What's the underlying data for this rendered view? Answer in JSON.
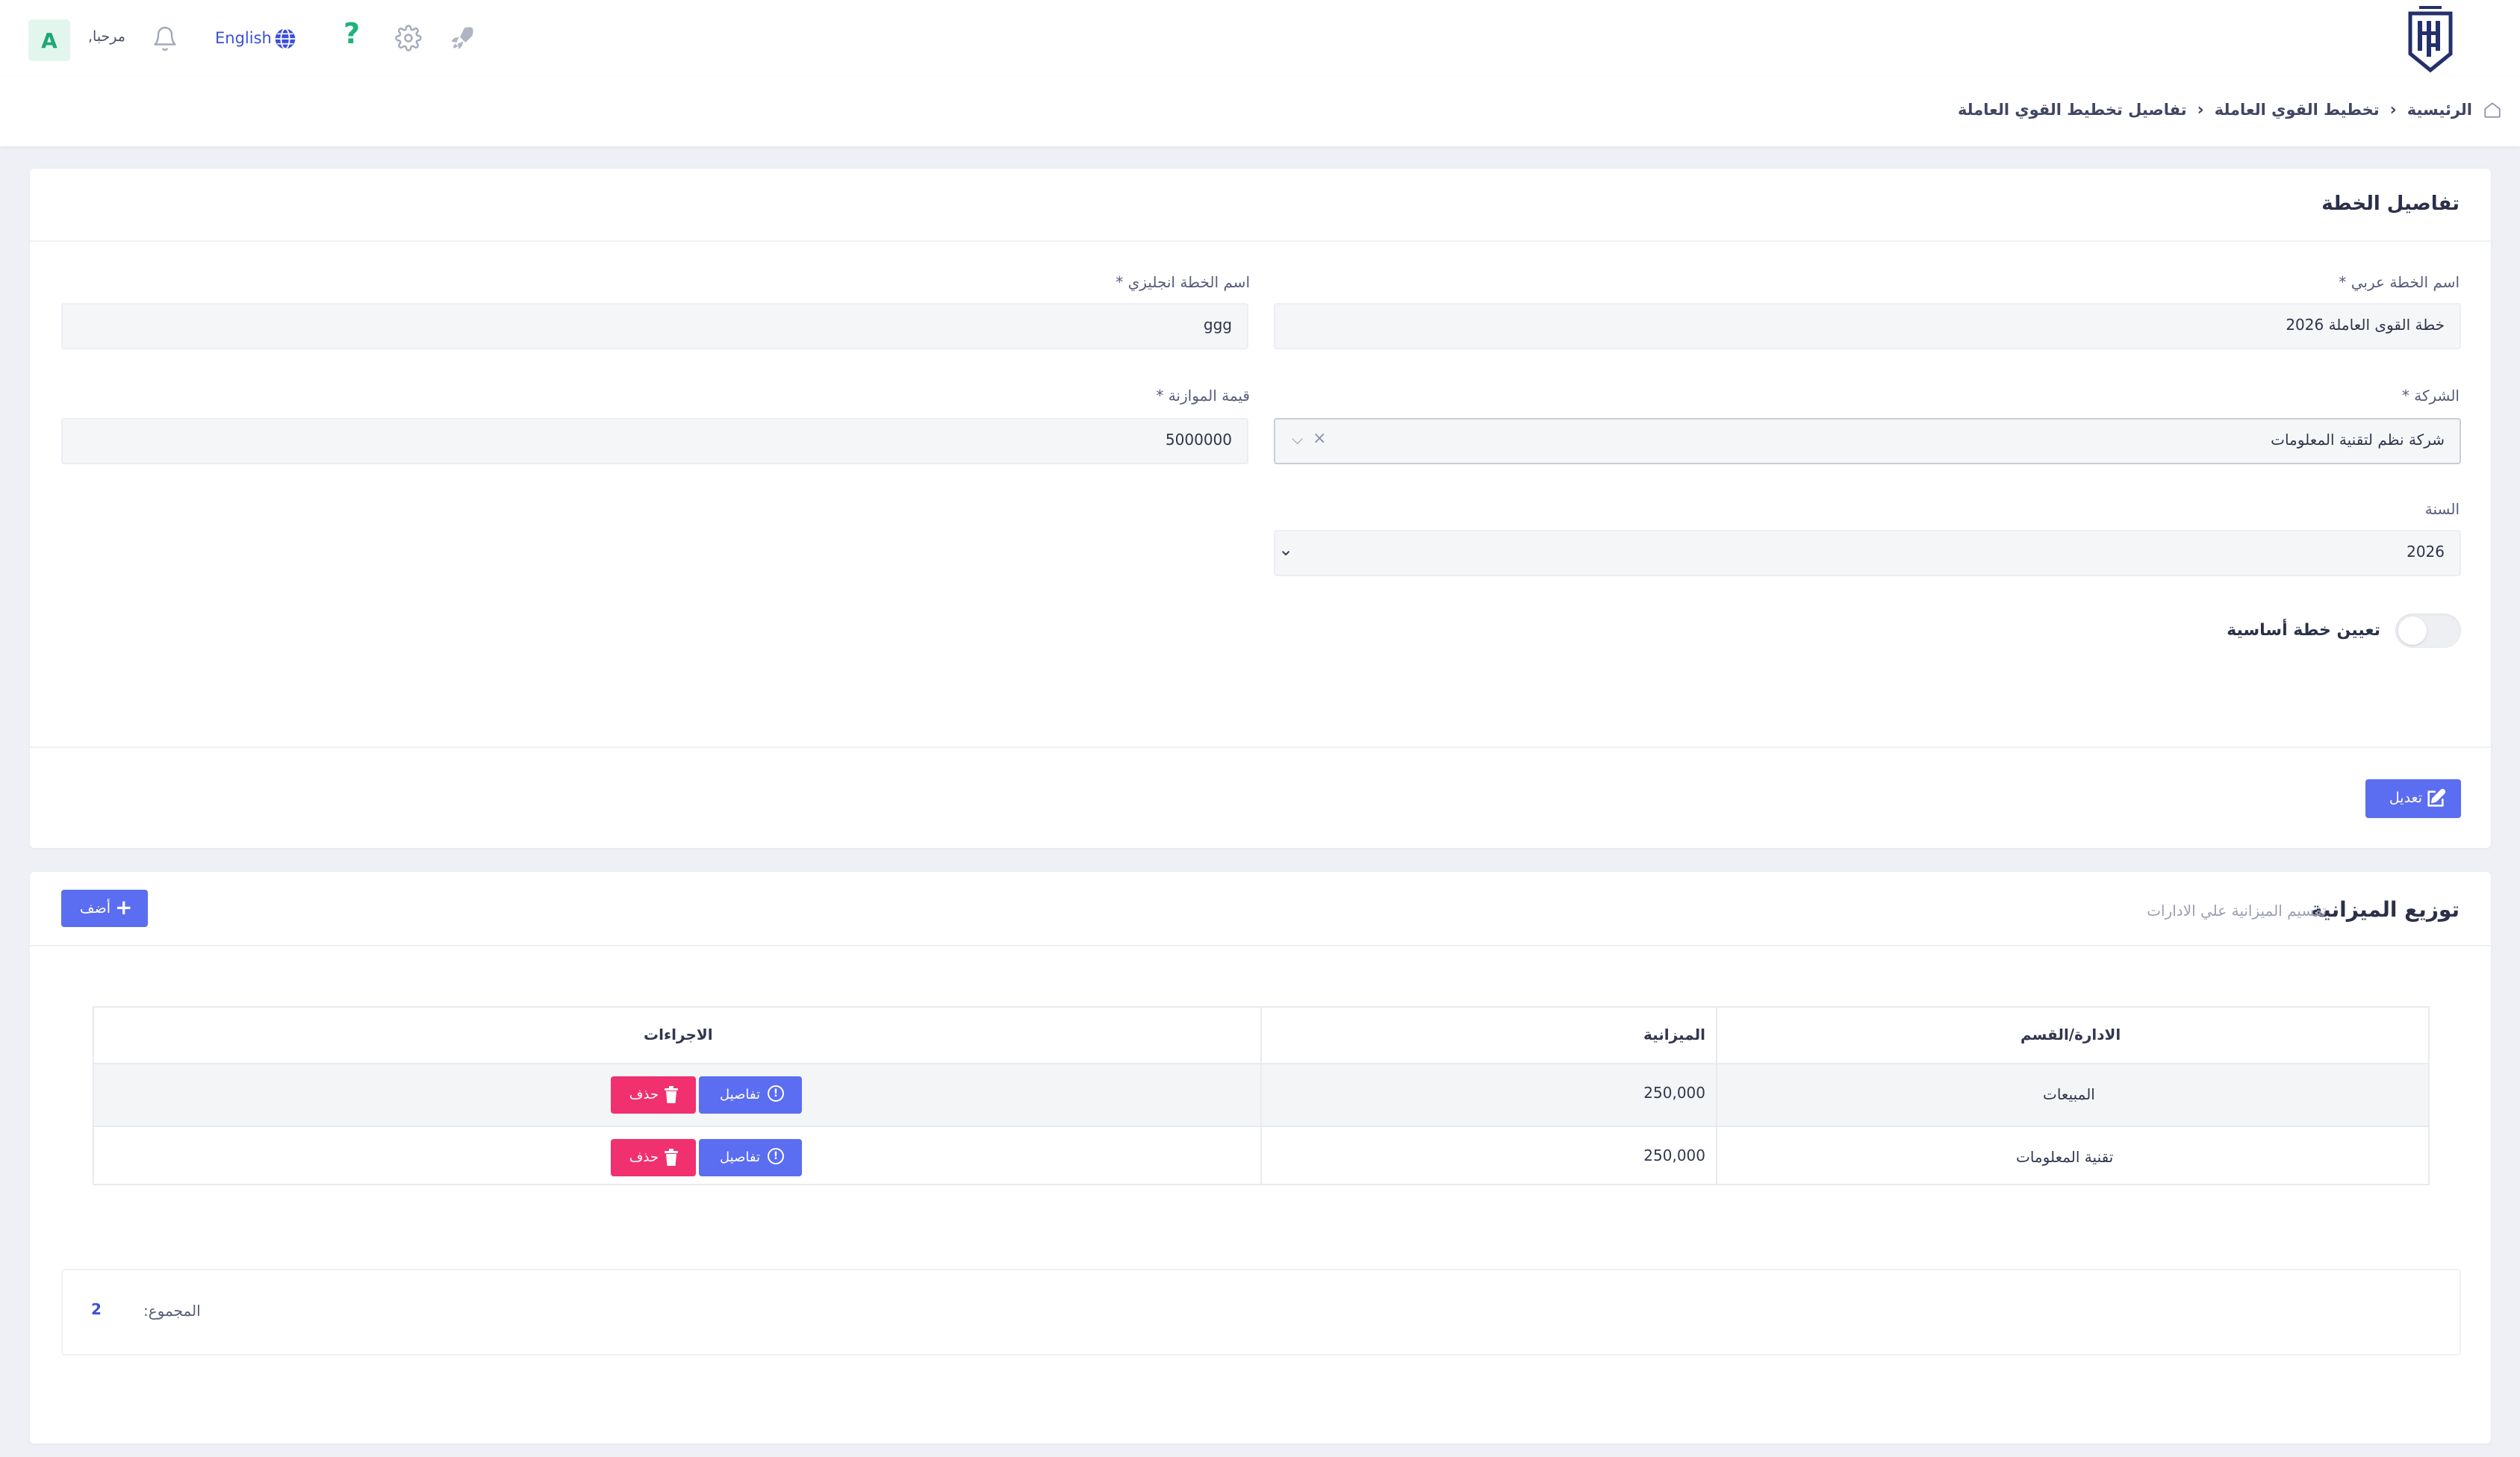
{
  "header": {
    "avatar_letter": "A",
    "greeting": "مرحبا,",
    "language": "English",
    "logo_name": "company-logo"
  },
  "breadcrumb": {
    "home": "الرئيسية",
    "section": "تخطيط القوي العاملة",
    "current": "تفاصيل تخطيط القوي العاملة"
  },
  "plan_details": {
    "title": "تفاصيل الخطة",
    "arabic_name_label": "اسم الخطة عربي *",
    "arabic_name_value": "خطة القوى العاملة 2026",
    "english_name_label": "اسم الخطة انجليزي *",
    "english_name_value": "ggg",
    "company_label": "الشركة *",
    "company_value": "شركة نظم لتقنية المعلومات",
    "budget_label": "قيمة الموازنة *",
    "budget_value": "5000000",
    "year_label": "السنة",
    "year_value": "2026",
    "base_plan_label": "تعيين خطة أساسية",
    "base_plan_enabled": false,
    "edit_button": "تعديل"
  },
  "budget_distribution": {
    "title": "توزيع الميزانية",
    "subtitle": "تقسيم الميزانية علي الادارات",
    "add_button": "أضف",
    "columns": {
      "department": "الادارة/القسم",
      "budget": "الميزانية",
      "actions": "الاجراءات"
    },
    "rows": [
      {
        "department": "المبيعات",
        "budget": "250,000",
        "details": "تفاصيل",
        "delete": "حذف"
      },
      {
        "department": "تقنية المعلومات",
        "budget": "250,000",
        "details": "تفاصيل",
        "delete": "حذف"
      }
    ],
    "total_label": "المجموع:",
    "total_value": "2"
  },
  "colors": {
    "primary": "#5b6df0",
    "danger": "#f1306f",
    "avatar_bg": "#e3f6ee",
    "avatar_text": "#1fa676",
    "help_icon": "#1db37a",
    "logo": "#23306b"
  }
}
